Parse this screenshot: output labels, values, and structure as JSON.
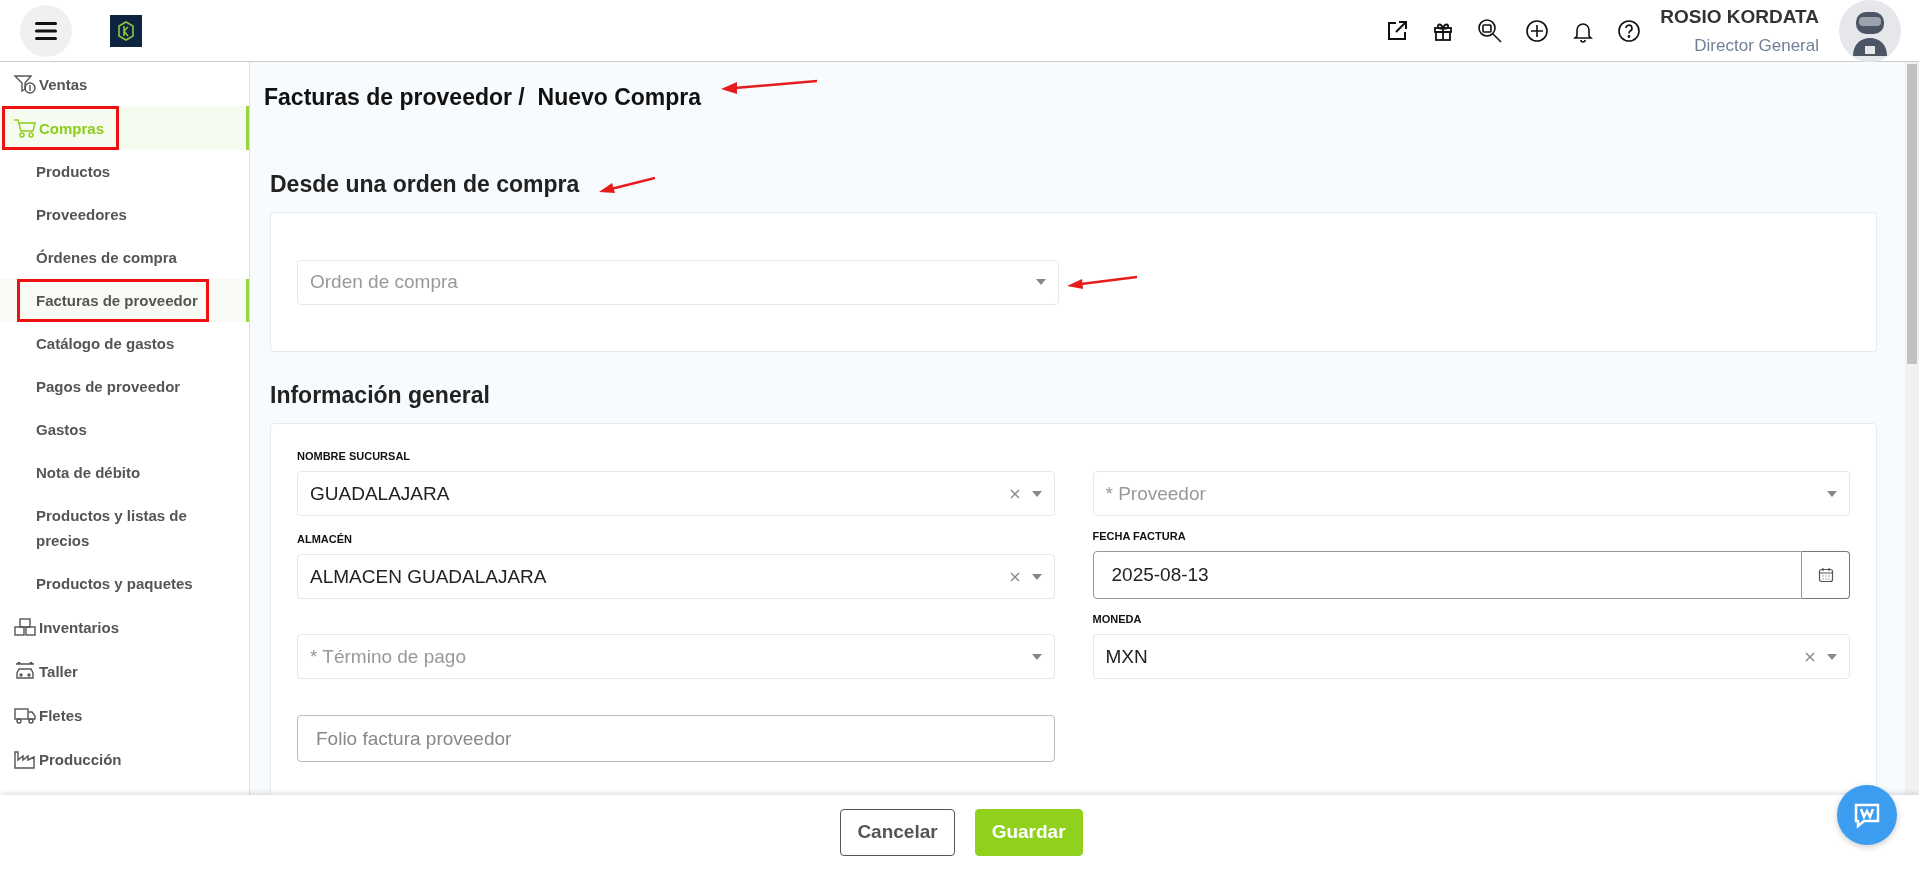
{
  "header": {
    "user_name": "ROSIO KORDATA",
    "user_role": "Director General"
  },
  "sidebar": {
    "items": [
      {
        "label": "Ventas",
        "selected": false,
        "marked": false
      },
      {
        "label": "Compras",
        "selected": true,
        "marked": true,
        "children": [
          {
            "label": "Productos",
            "selected": false,
            "marked": false
          },
          {
            "label": "Proveedores",
            "selected": false,
            "marked": false
          },
          {
            "label": "Órdenes de compra",
            "selected": false,
            "marked": false
          },
          {
            "label": "Facturas de proveedor",
            "selected": true,
            "marked": true
          },
          {
            "label": "Catálogo de gastos",
            "selected": false,
            "marked": false
          },
          {
            "label": "Pagos de proveedor",
            "selected": false,
            "marked": false
          },
          {
            "label": "Gastos",
            "selected": false,
            "marked": false
          },
          {
            "label": "Nota de débito",
            "selected": false,
            "marked": false
          },
          {
            "label": "Productos y listas de precios",
            "selected": false,
            "marked": false
          },
          {
            "label": "Productos y paquetes",
            "selected": false,
            "marked": false
          }
        ]
      },
      {
        "label": "Inventarios",
        "selected": false,
        "marked": false
      },
      {
        "label": "Taller",
        "selected": false,
        "marked": false
      },
      {
        "label": "Fletes",
        "selected": false,
        "marked": false
      },
      {
        "label": "Producción",
        "selected": false,
        "marked": false
      }
    ]
  },
  "breadcrumb": {
    "parent": "Facturas de proveedor /",
    "current": "Nuevo Compra",
    "marked": true
  },
  "purchase_order_section": {
    "title": "Desde una orden de compra",
    "title_marked": true,
    "field": {
      "placeholder": "Orden de compra",
      "marked": true
    }
  },
  "general_section": {
    "title": "Información general",
    "fields": [
      {
        "kind": "select",
        "label": "NOMBRE SUCURSAL",
        "value": "GUADALAJARA",
        "clearable": true
      },
      {
        "kind": "select",
        "placeholder": "* Proveedor",
        "clearable": false
      },
      {
        "kind": "select",
        "label": "ALMACÉN",
        "value": "ALMACEN GUADALAJARA",
        "clearable": true
      },
      {
        "kind": "date",
        "label": "FECHA FACTURA",
        "value": "2025-08-13"
      },
      {
        "kind": "select",
        "placeholder": "* Término de pago",
        "clearable": false
      },
      {
        "kind": "select",
        "label": "MONEDA",
        "value": "MXN",
        "clearable": true
      },
      {
        "kind": "text",
        "placeholder": "Folio factura proveedor"
      }
    ]
  },
  "footer": {
    "buttons": [
      {
        "label": "Cancelar",
        "kind": "secondary"
      },
      {
        "label": "Guardar",
        "kind": "primary"
      }
    ]
  }
}
